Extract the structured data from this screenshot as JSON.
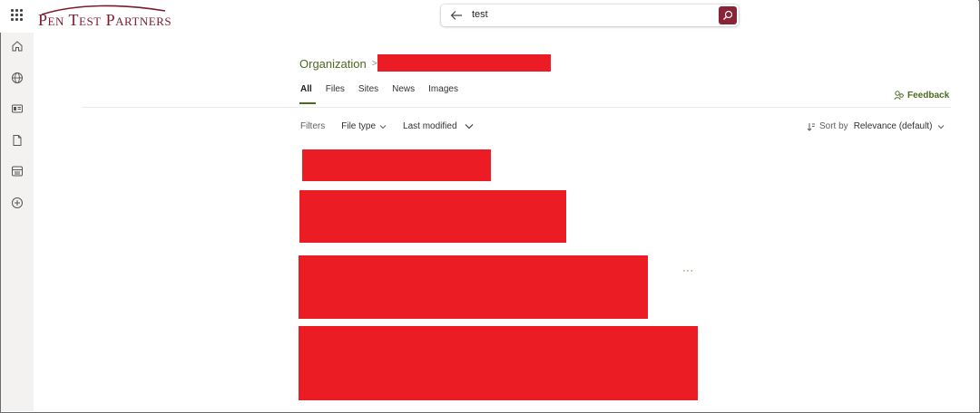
{
  "header": {
    "logo_text": "Pen Test Partners",
    "search": {
      "value": "test"
    }
  },
  "rail": {
    "items": [
      {
        "name": "home-icon"
      },
      {
        "name": "globe-icon"
      },
      {
        "name": "news-icon"
      },
      {
        "name": "file-icon"
      },
      {
        "name": "list-icon"
      },
      {
        "name": "add-icon"
      }
    ]
  },
  "breadcrumb": {
    "root": "Organization",
    "separator": ">"
  },
  "tabs": [
    {
      "label": "All",
      "active": true
    },
    {
      "label": "Files",
      "active": false
    },
    {
      "label": "Sites",
      "active": false
    },
    {
      "label": "News",
      "active": false
    },
    {
      "label": "Images",
      "active": false
    }
  ],
  "feedback": {
    "label": "Feedback"
  },
  "filters": {
    "label": "Filters",
    "file_type": "File type",
    "last_modified": "Last modified"
  },
  "sort": {
    "label": "Sort by",
    "value": "Relevance (default)"
  },
  "results": {
    "more_label": "···"
  },
  "colors": {
    "accent": "#4a6b20",
    "brand": "#8a2336",
    "redaction": "#ec1c24",
    "rail_bg": "#f3f2f1"
  }
}
